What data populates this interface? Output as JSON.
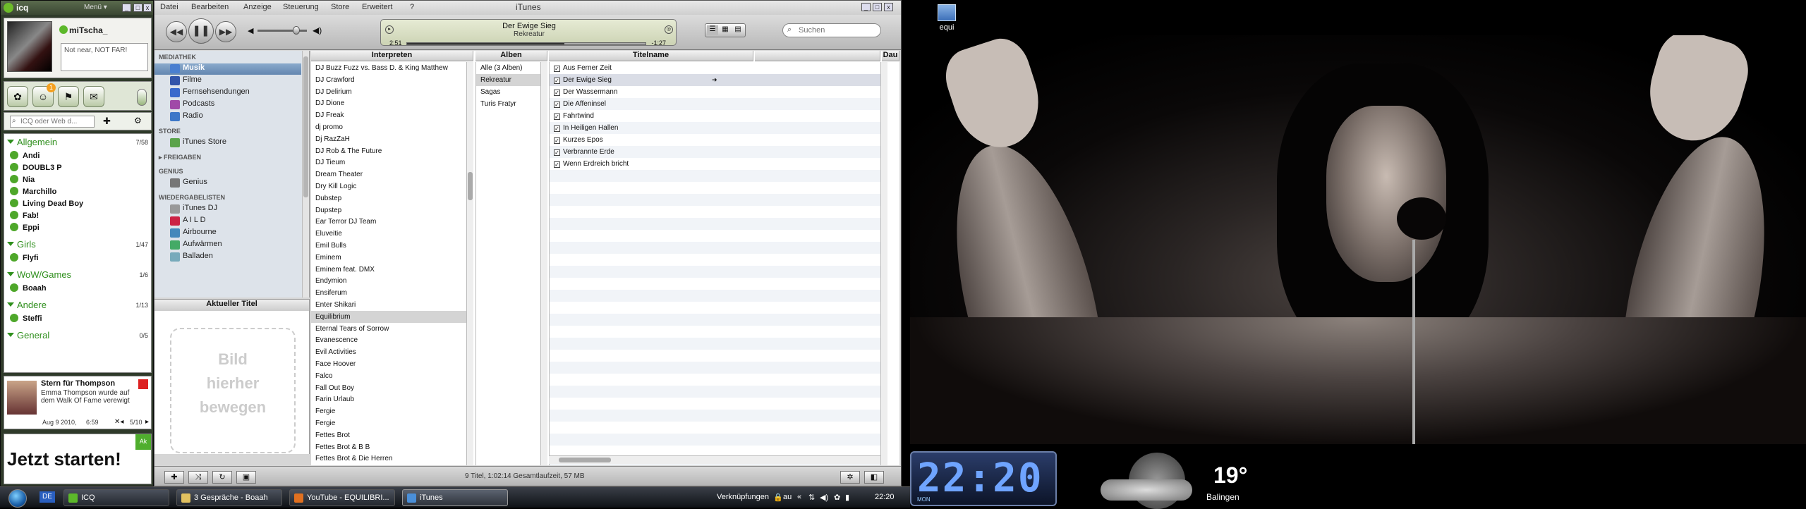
{
  "icq": {
    "title": "icq",
    "menu_label": "Menü",
    "nick": "miTscha_",
    "status_message": "Not near, NOT FAR!",
    "tab_badge": "1",
    "search_placeholder": "ICQ oder Web d...",
    "groups": [
      {
        "name": "Allgemein",
        "count": "7/58",
        "contacts": [
          "Andi",
          "DOUBL3 P",
          "Nia",
          "Marchillo",
          "Living Dead Boy",
          "Fab!",
          "Eppi"
        ]
      },
      {
        "name": "Girls",
        "count": "1/47",
        "contacts": [
          "Flyfi"
        ]
      },
      {
        "name": "WoW/Games",
        "count": "1/6",
        "contacts": [
          "Boaah"
        ]
      },
      {
        "name": "Andere",
        "count": "1/13",
        "contacts": [
          "Steffi"
        ]
      },
      {
        "name": "General",
        "count": "0/5",
        "contacts": []
      }
    ],
    "news": {
      "headline": "Stern für Thompson",
      "body": "Emma Thompson wurde auf dem Walk Of Fame verewigt",
      "date": "Aug 9 2010,",
      "time": "6:59",
      "pager": "5/10"
    },
    "banner": "Jetzt starten!",
    "banner_corner": "Ak"
  },
  "itunes": {
    "menu": [
      "Datei",
      "Bearbeiten",
      "Anzeige",
      "Steuerung",
      "Store",
      "Erweitert",
      "?"
    ],
    "window_title": "iTunes",
    "now_playing": {
      "title": "Der Ewige Sieg",
      "artist": "Rekreatur",
      "elapsed": "2:51",
      "remaining": "-1:27",
      "progress": 0.66
    },
    "search_placeholder": "Suchen",
    "source": {
      "sections": [
        {
          "header": "MEDIATHEK",
          "items": [
            "Musik",
            "Filme",
            "Fernsehsendungen",
            "Podcasts",
            "Radio"
          ]
        },
        {
          "header": "STORE",
          "items": [
            "iTunes Store"
          ]
        },
        {
          "header": "FREIGABEN",
          "items": []
        },
        {
          "header": "GENIUS",
          "items": [
            "Genius"
          ]
        },
        {
          "header": "WIEDERGABELISTEN",
          "items": [
            "iTunes DJ",
            "A I L D",
            "Airbourne",
            "Aufwärmen",
            "Balladen"
          ]
        }
      ],
      "selected": "Musik"
    },
    "artwork_header": "Aktueller Titel",
    "artwork_placeholder": [
      "Bild",
      "hierher",
      "bewegen"
    ],
    "columns": {
      "artists": "Interpreten",
      "albums": "Alben",
      "title": "Titelname",
      "duration": "Dau"
    },
    "artists": [
      "DJ Buzz Fuzz vs. Bass D. & King Matthew",
      "DJ Crawford",
      "DJ Delirium",
      "DJ Dione",
      "DJ Freak",
      "dj promo",
      "Dj RazZaH",
      "DJ Rob & The Future",
      "DJ Tieum",
      "Dream Theater",
      "Dry Kill Logic",
      "Dubstep",
      "Dupstep",
      "Ear Terror DJ Team",
      "Eluveitie",
      "Emil Bulls",
      "Eminem",
      "Eminem feat. DMX",
      "Endymion",
      "Ensiferum",
      "Enter Shikari",
      "Equilibrium",
      "Eternal Tears of Sorrow",
      "Evanescence",
      "Evil Activities",
      "Face Hoover",
      "Falco",
      "Fall Out Boy",
      "Farin Urlaub",
      "Fergie",
      "Fergie",
      "Fettes Brot",
      "Fettes Brot & B B",
      "Fettes Brot & Die Herren"
    ],
    "selected_artist": "Equilibrium",
    "albums": [
      "Alle (3 Alben)",
      "Rekreatur",
      "Sagas",
      "Turis Fratyr"
    ],
    "selected_album": "Rekreatur",
    "tracks": [
      "Aus Ferner Zeit",
      "Der Ewige Sieg",
      "Der Wassermann",
      "Die Affeninsel",
      "Fahrtwind",
      "In Heiligen Hallen",
      "Kurzes Epos",
      "Verbrannte Erde",
      "Wenn Erdreich bricht"
    ],
    "playing_track": "Der Ewige Sieg",
    "status": "9 Titel, 1:02:14 Gesamtlaufzeit, 57 MB"
  },
  "desktop": {
    "icon_label": "equi",
    "clock": {
      "time": "22:20",
      "day": "MON"
    },
    "weather": {
      "temp": "19°",
      "city": "Balingen"
    }
  },
  "taskbar": {
    "lang": "DE",
    "tasks": [
      {
        "label": "ICQ",
        "color": "#5cb82a"
      },
      {
        "label": "3 Gespräche - Boaah",
        "color": "#e0c060"
      },
      {
        "label": "YouTube - EQUILIBRI...",
        "color": "#e07020"
      },
      {
        "label": "iTunes",
        "color": "#4a8fd8"
      }
    ],
    "tray_links": "Verknüpfungen",
    "tray_extra": "au",
    "tray_time": "22:20"
  }
}
